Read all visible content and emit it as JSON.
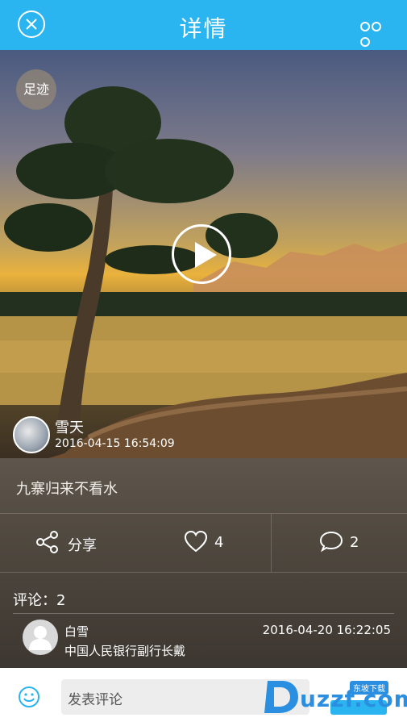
{
  "header": {
    "title": "详情"
  },
  "media": {
    "footprint_label": "足迹",
    "author_name": "雪天",
    "post_time": "2016-04-15 16:54:09"
  },
  "post": {
    "caption": "九寨归来不看水"
  },
  "actions": {
    "share_label": "分享",
    "like_count": "4",
    "comment_count": "2"
  },
  "comments": {
    "heading": "评论：2",
    "items": [
      {
        "name": "白雪",
        "text": "中国人民银行副行长戴",
        "time": "2016-04-20 16:22:05"
      }
    ]
  },
  "input": {
    "placeholder": "发表评论"
  },
  "watermark": {
    "text": "uzzf.com",
    "badge": "东坡下载"
  },
  "colors": {
    "accent": "#2bb5f0"
  }
}
